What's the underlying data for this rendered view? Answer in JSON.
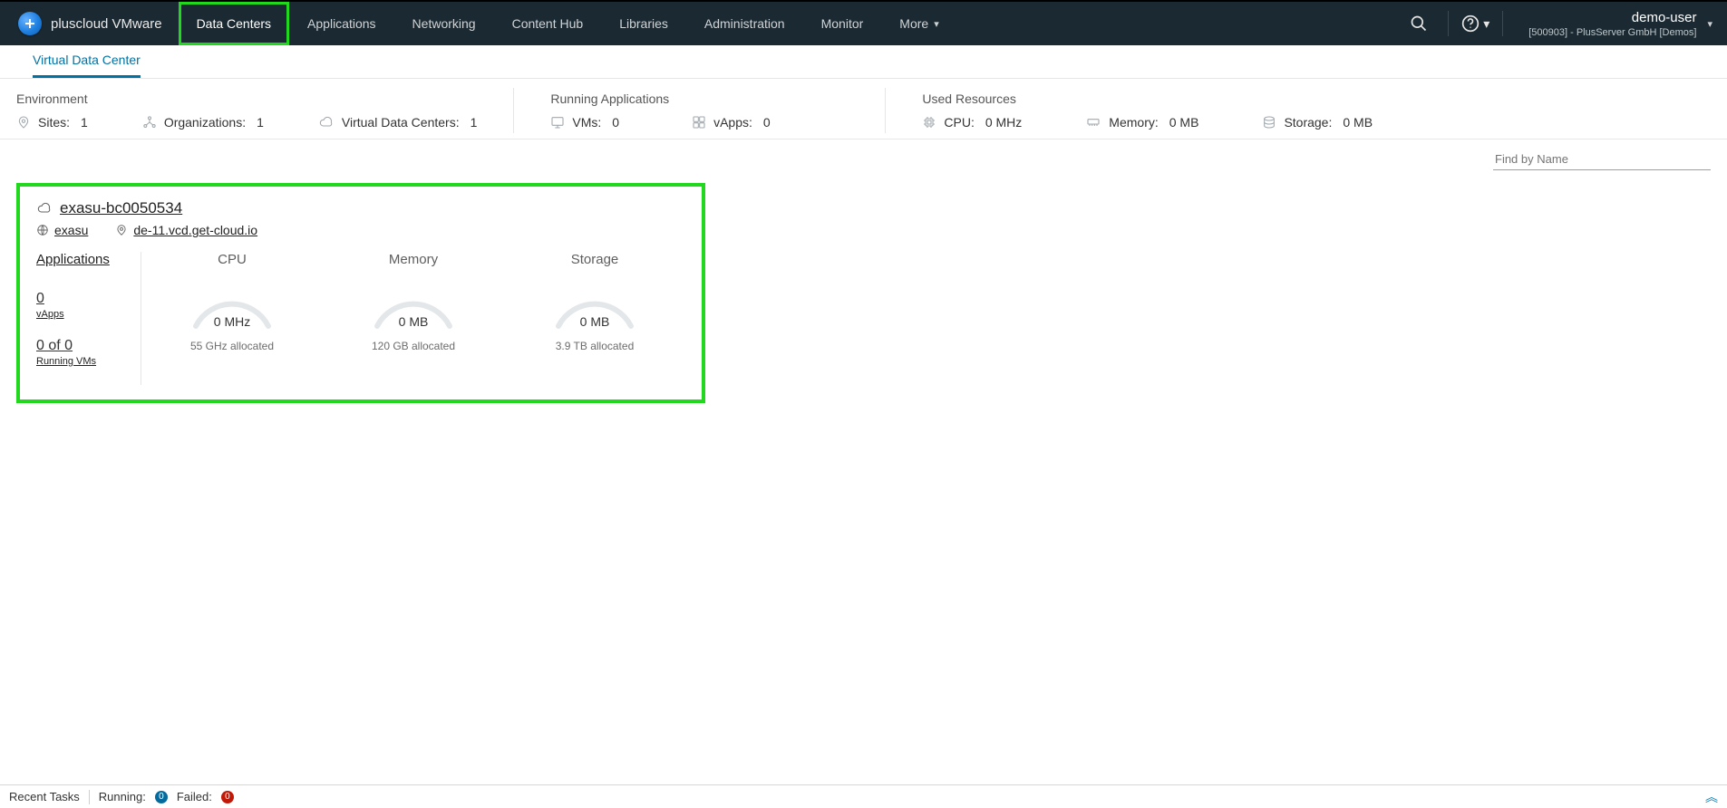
{
  "brand": {
    "title": "pluscloud VMware"
  },
  "nav": {
    "items": [
      {
        "label": "Data Centers",
        "active": true,
        "box": true
      },
      {
        "label": "Applications"
      },
      {
        "label": "Networking"
      },
      {
        "label": "Content Hub"
      },
      {
        "label": "Libraries"
      },
      {
        "label": "Administration"
      },
      {
        "label": "Monitor"
      },
      {
        "label": "More",
        "dropdown": true
      }
    ]
  },
  "user": {
    "name": "demo-user",
    "org": "[500903] - PlusServer GmbH [Demos]"
  },
  "subtabs": [
    {
      "label": "Virtual Data Center",
      "active": true
    }
  ],
  "summary": {
    "env": {
      "title": "Environment",
      "sites": {
        "label": "Sites:",
        "value": "1"
      },
      "orgs": {
        "label": "Organizations:",
        "value": "1"
      },
      "vdcs": {
        "label": "Virtual Data Centers:",
        "value": "1"
      }
    },
    "run": {
      "title": "Running Applications",
      "vms": {
        "label": "VMs:",
        "value": "0"
      },
      "vapps": {
        "label": "vApps:",
        "value": "0"
      }
    },
    "used": {
      "title": "Used Resources",
      "cpu": {
        "label": "CPU:",
        "value": "0 MHz"
      },
      "memory": {
        "label": "Memory:",
        "value": "0 MB"
      },
      "storage": {
        "label": "Storage:",
        "value": "0 MB"
      }
    }
  },
  "find": {
    "placeholder": "Find by Name"
  },
  "card": {
    "name": "exasu-bc0050534",
    "org": "exasu",
    "site": "de-11.vcd.get-cloud.io",
    "apps_label": "Applications",
    "vapps_count": "0",
    "vapps_label": "vApps",
    "running_vms": "0 of 0",
    "running_vms_label": "Running VMs",
    "gauges": {
      "cpu": {
        "title": "CPU",
        "value": "0 MHz",
        "alloc": "55 GHz allocated"
      },
      "memory": {
        "title": "Memory",
        "value": "0 MB",
        "alloc": "120 GB allocated"
      },
      "storage": {
        "title": "Storage",
        "value": "0 MB",
        "alloc": "3.9 TB allocated"
      }
    }
  },
  "tasks": {
    "title": "Recent Tasks",
    "running_label": "Running:",
    "running_count": "0",
    "failed_label": "Failed:",
    "failed_count": "0"
  }
}
